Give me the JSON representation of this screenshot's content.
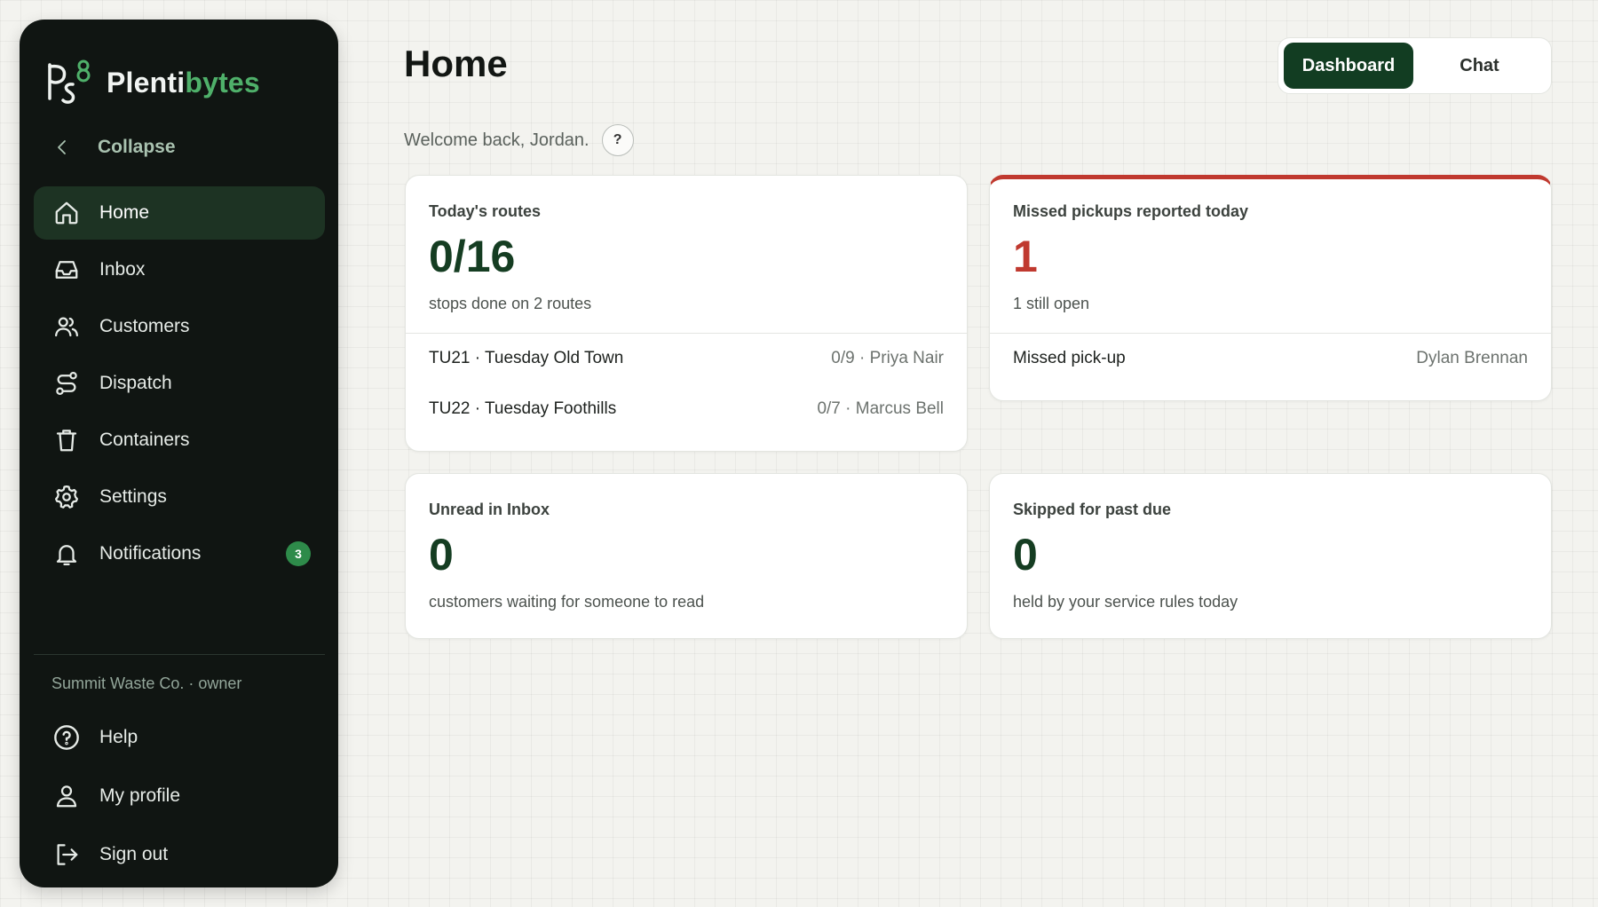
{
  "brand": {
    "name_a": "Plenti",
    "name_b": "bytes"
  },
  "sidebar": {
    "collapse_label": "Collapse",
    "items": [
      {
        "label": "Home",
        "icon": "home-icon",
        "active": true
      },
      {
        "label": "Inbox",
        "icon": "inbox-icon"
      },
      {
        "label": "Customers",
        "icon": "users-icon"
      },
      {
        "label": "Dispatch",
        "icon": "route-icon"
      },
      {
        "label": "Containers",
        "icon": "bin-icon"
      },
      {
        "label": "Settings",
        "icon": "gear-icon"
      },
      {
        "label": "Notifications",
        "icon": "bell-icon",
        "badge": "3"
      }
    ],
    "org": "Summit Waste Co. · owner",
    "bottom_items": [
      {
        "label": "Help",
        "icon": "help-icon"
      },
      {
        "label": "My profile",
        "icon": "user-icon"
      },
      {
        "label": "Sign out",
        "icon": "sign-out-icon"
      }
    ]
  },
  "header": {
    "title": "Home",
    "welcome": "Welcome back, Jordan.",
    "help_symbol": "?",
    "view_toggle": {
      "dashboard": "Dashboard",
      "chat": "Chat",
      "selected": "Dashboard"
    }
  },
  "cards": {
    "routes": {
      "label": "Today's routes",
      "value": "0/16",
      "sub": "stops done on 2 routes",
      "rows": [
        {
          "left": "TU21 · Tuesday Old Town",
          "right": "0/9 · Priya Nair"
        },
        {
          "left": "TU22 · Tuesday Foothills",
          "right": "0/7 · Marcus Bell"
        }
      ]
    },
    "missed": {
      "label": "Missed pickups reported today",
      "value": "1",
      "sub": "1 still open",
      "accent": "#c0392f",
      "rows": [
        {
          "left": "Missed pick-up",
          "right": "Dylan Brennan"
        }
      ]
    },
    "unread": {
      "label": "Unread in Inbox",
      "value": "0",
      "sub": "customers waiting for someone to read"
    },
    "skipped": {
      "label": "Skipped for past due",
      "value": "0",
      "sub": "held by your service rules today"
    }
  },
  "colors": {
    "sidebar_bg": "#101512",
    "accent_green": "#123d22",
    "brand_green": "#4fb06a",
    "alert_red": "#c0392f"
  }
}
